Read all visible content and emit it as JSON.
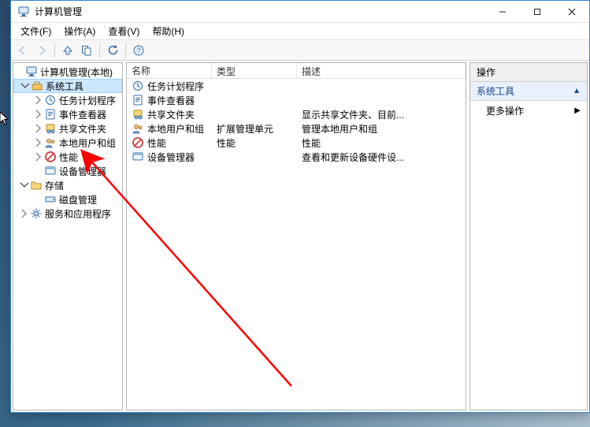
{
  "colors": {
    "accent": "#cce8ff"
  },
  "window": {
    "title": "计算机管理"
  },
  "menu": {
    "file": "文件(F)",
    "action": "操作(A)",
    "view": "查看(V)",
    "help": "帮助(H)"
  },
  "tree": {
    "root": "计算机管理(本地)",
    "system_tools": "系统工具",
    "task_scheduler": "任务计划程序",
    "event_viewer": "事件查看器",
    "shared_folders": "共享文件夹",
    "local_users": "本地用户和组",
    "performance": "性能",
    "device_manager": "设备管理器",
    "storage": "存储",
    "disk_mgmt": "磁盘管理",
    "services_apps": "服务和应用程序"
  },
  "list": {
    "headers": {
      "name": "名称",
      "type": "类型",
      "desc": "描述"
    },
    "rows": [
      {
        "icon": "clock",
        "name": "任务计划程序",
        "type": "",
        "desc": ""
      },
      {
        "icon": "event",
        "name": "事件查看器",
        "type": "",
        "desc": ""
      },
      {
        "icon": "share",
        "name": "共享文件夹",
        "type": "",
        "desc": "显示共享文件夹、目前..."
      },
      {
        "icon": "users",
        "name": "本地用户和组",
        "type": "扩展管理单元",
        "desc": "管理本地用户和组"
      },
      {
        "icon": "forbid",
        "name": "性能",
        "type": "性能",
        "desc": "性能"
      },
      {
        "icon": "device",
        "name": "设备管理器",
        "type": "",
        "desc": "查看和更新设备硬件设..."
      }
    ]
  },
  "actions": {
    "title": "操作",
    "section": "系统工具",
    "more": "更多操作"
  }
}
